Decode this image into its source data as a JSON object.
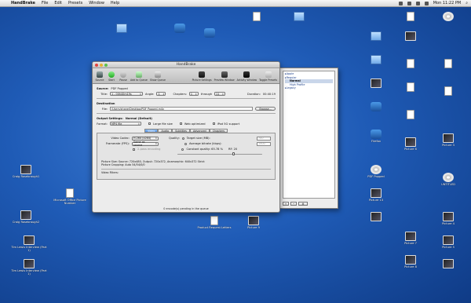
{
  "menubar": {
    "app_name": "HandBrake",
    "menus": [
      "File",
      "Edit",
      "Presets",
      "Window",
      "Help"
    ],
    "clock": "Mon 11:22 PM"
  },
  "desktop_icons_left": [
    {
      "label": "Craig Rosebraugh1",
      "kind": "pic"
    },
    {
      "label": "Microsoft Office Picture Number",
      "kind": "doc"
    },
    {
      "label": "Craig Rosebraugh2",
      "kind": "pic"
    },
    {
      "label": "Tim Lewis Interview (Part 1)",
      "kind": "pic"
    },
    {
      "label": "Tim Lewis Interview (Part 1)",
      "kind": "pic"
    }
  ],
  "desktop_icons_top": [
    {
      "label": "",
      "kind": "folder"
    },
    {
      "label": "",
      "kind": "app"
    },
    {
      "label": "",
      "kind": "app"
    },
    {
      "label": "",
      "kind": "doc"
    },
    {
      "label": "",
      "kind": "folder"
    }
  ],
  "desktop_icons_right_col1": [
    {
      "label": "",
      "kind": "folder"
    },
    {
      "label": "",
      "kind": "folder"
    },
    {
      "label": "",
      "kind": "pic"
    },
    {
      "label": "",
      "kind": "app"
    },
    {
      "label": "Firefox",
      "kind": "app"
    },
    {
      "label": "PDF Popped",
      "kind": "disk"
    },
    {
      "label": "Picture 13",
      "kind": "pic"
    },
    {
      "label": "",
      "kind": "pic"
    }
  ],
  "desktop_icons_right_col2": [
    {
      "label": "",
      "kind": "doc"
    },
    {
      "label": "",
      "kind": "pic"
    },
    {
      "label": "",
      "kind": "doc"
    },
    {
      "label": "",
      "kind": "doc"
    },
    {
      "label": "",
      "kind": "doc"
    },
    {
      "label": "Picture 6",
      "kind": "pic"
    },
    {
      "label": "Picture 7",
      "kind": "pic"
    },
    {
      "label": "Picture 8",
      "kind": "pic"
    }
  ],
  "desktop_icons_right_col3": [
    {
      "label": "",
      "kind": "disk"
    },
    {
      "label": "",
      "kind": "doc"
    },
    {
      "label": "",
      "kind": "doc"
    },
    {
      "label": "Picture 3",
      "kind": "pic"
    },
    {
      "label": "Picture 4",
      "kind": "pic"
    },
    {
      "label": "Picture 5",
      "kind": "pic"
    },
    {
      "label": "UNTITLED",
      "kind": "disk"
    },
    {
      "label": "",
      "kind": "pic"
    }
  ],
  "desktop_icons_bottom": [
    {
      "label": "Product Request Letters",
      "kind": "doc"
    },
    {
      "label": "Picture 9",
      "kind": "pic"
    }
  ],
  "window": {
    "title": "HandBrake",
    "toolbar": [
      "Source",
      "Start",
      "Pause",
      "Add to Queue",
      "Show Queue",
      "Picture Settings",
      "Preview Window",
      "Activity Window",
      "Toggle Presets"
    ],
    "source_label": "Source:",
    "source_value": "PDF Popped",
    "title_label": "Title:",
    "title_value": "1 - 00h40m19s",
    "angle_label": "Angle:",
    "angle_value": "1",
    "chapters_label": "Chapters:",
    "chapter_from": "1",
    "through_label": "through",
    "chapter_to": "11",
    "duration_label": "Duration:",
    "duration_value": "00:40:19",
    "destination_heading": "Destination",
    "file_label": "File:",
    "file_path": "/Users/shane/Desktop/PDF Popped.m4v",
    "browse_label": "Browse...",
    "output_heading": "Output Settings:",
    "output_preset": "Normal (Default)",
    "format_label": "Format:",
    "format_value": "MP4 file",
    "large_file_label": "Large file size",
    "web_optimized_label": "Web optimized",
    "ipod_label": "iPod 5G support",
    "tabs": [
      "Video",
      "Audio",
      "Subtitles",
      "Advanced",
      "Chapters"
    ],
    "active_tab": "Video",
    "video_codec_label": "Video Codec:",
    "video_codec_value": "H.264 (x264)",
    "framerate_label": "Framerate (FPS):",
    "framerate_value": "Same as source",
    "two_pass_label": "2-pass encoding",
    "quality_label": "Quality:",
    "target_size_label": "Target size (MB):",
    "target_size_value": "700",
    "avg_bitrate_label": "Average bitrate (kbps):",
    "avg_bitrate_value": "1500",
    "constant_quality_label": "Constant quality: 65.78 %",
    "rf_label": "RF: 20",
    "quality_fraction": 0.6578,
    "picture_size": "Picture Size: Source: 720x480, Output: 720x372, Anamorphic: 640x372 Strict",
    "picture_cropping": "Picture Cropping: Auto 54/54/0/0",
    "video_filters": "Video Filters:",
    "status": "0 encode(s) pending in the queue"
  },
  "presets": {
    "items": [
      {
        "label": "Apple",
        "level": 0,
        "selected": false
      },
      {
        "label": "Regular",
        "level": 0,
        "selected": false
      },
      {
        "label": "Normal",
        "level": 1,
        "selected": true
      },
      {
        "label": "High Profile",
        "level": 1,
        "selected": false
      },
      {
        "label": "Legacy",
        "level": 0,
        "selected": false
      }
    ],
    "add_label": "+",
    "remove_label": "−",
    "gear_label": "⚙"
  }
}
